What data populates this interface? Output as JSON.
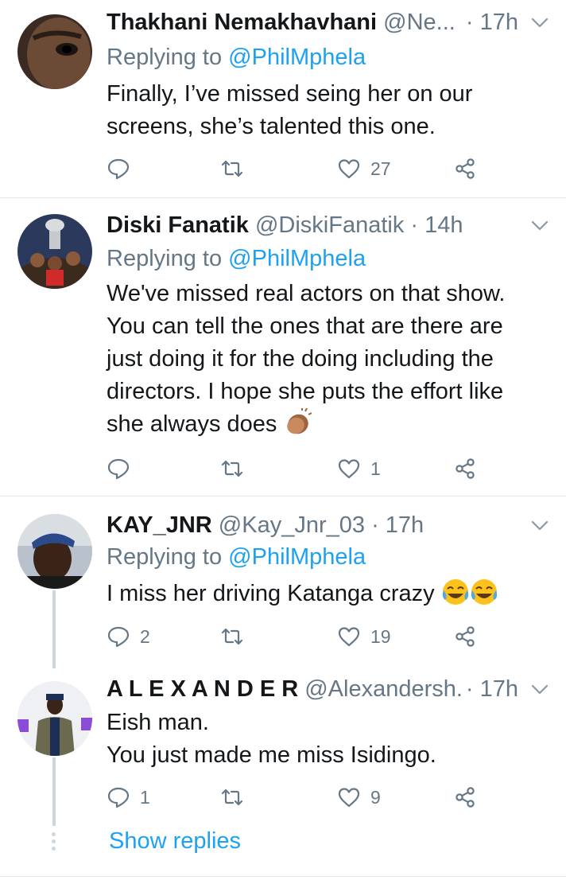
{
  "tweets": [
    {
      "name": "Thakhani Nemakhavhani",
      "handle": "@Ne...",
      "time": "· 17h",
      "replying_label": "Replying to",
      "replying_handle": "@PhilMphela",
      "text": "Finally, I’ve missed seing her on our\nscreens, she’s talented this one.",
      "reply_count": "",
      "retweet_count": "",
      "like_count": "27"
    },
    {
      "name": "Diski Fanatik",
      "handle": "@DiskiFanatik",
      "time": "· 14h",
      "replying_label": "Replying to",
      "replying_handle": "@PhilMphela",
      "text": "We've missed real actors on that show.\nYou can tell the ones that are there are\njust doing it for the doing including the\ndirectors. I hope she puts the effort like\nshe always does",
      "reply_count": "",
      "retweet_count": "",
      "like_count": "1"
    },
    {
      "name": "KAY_JNR",
      "handle": "@Kay_Jnr_03",
      "time": "· 17h",
      "replying_label": "Replying to",
      "replying_handle": "@PhilMphela",
      "text": "I miss her driving Katanga crazy",
      "reply_count": "2",
      "retweet_count": "",
      "like_count": "19"
    },
    {
      "name": "A L E X A N D E R",
      "handle": "@Alexandersh...",
      "time": "· 17h",
      "text": "Eish man.\nYou just made me miss Isidingo.",
      "reply_count": "1",
      "retweet_count": "",
      "like_count": "9"
    }
  ],
  "show_replies": "Show replies",
  "colors": {
    "accent": "#1da1f2",
    "muted": "#657786",
    "text": "#14171a",
    "divider": "#e1e8ed"
  },
  "icons": [
    "reply-icon",
    "retweet-icon",
    "like-icon",
    "share-icon",
    "chevron-down-icon",
    "clapping-hands-emoji",
    "tears-of-joy-emoji"
  ]
}
